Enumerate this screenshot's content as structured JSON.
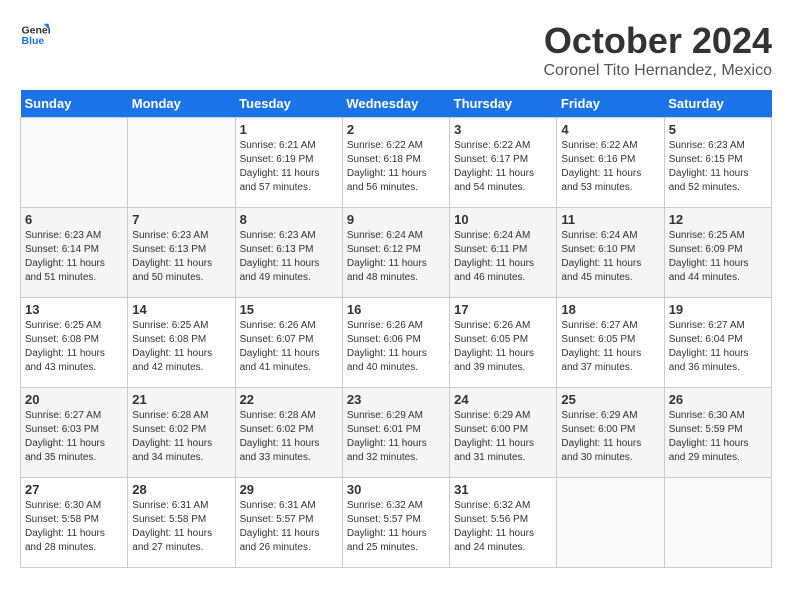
{
  "header": {
    "logo_general": "General",
    "logo_blue": "Blue",
    "month_title": "October 2024",
    "location": "Coronel Tito Hernandez, Mexico"
  },
  "days_of_week": [
    "Sunday",
    "Monday",
    "Tuesday",
    "Wednesday",
    "Thursday",
    "Friday",
    "Saturday"
  ],
  "weeks": [
    [
      {
        "day": "",
        "info": ""
      },
      {
        "day": "",
        "info": ""
      },
      {
        "day": "1",
        "info": "Sunrise: 6:21 AM\nSunset: 6:19 PM\nDaylight: 11 hours and 57 minutes."
      },
      {
        "day": "2",
        "info": "Sunrise: 6:22 AM\nSunset: 6:18 PM\nDaylight: 11 hours and 56 minutes."
      },
      {
        "day": "3",
        "info": "Sunrise: 6:22 AM\nSunset: 6:17 PM\nDaylight: 11 hours and 54 minutes."
      },
      {
        "day": "4",
        "info": "Sunrise: 6:22 AM\nSunset: 6:16 PM\nDaylight: 11 hours and 53 minutes."
      },
      {
        "day": "5",
        "info": "Sunrise: 6:23 AM\nSunset: 6:15 PM\nDaylight: 11 hours and 52 minutes."
      }
    ],
    [
      {
        "day": "6",
        "info": "Sunrise: 6:23 AM\nSunset: 6:14 PM\nDaylight: 11 hours and 51 minutes."
      },
      {
        "day": "7",
        "info": "Sunrise: 6:23 AM\nSunset: 6:13 PM\nDaylight: 11 hours and 50 minutes."
      },
      {
        "day": "8",
        "info": "Sunrise: 6:23 AM\nSunset: 6:13 PM\nDaylight: 11 hours and 49 minutes."
      },
      {
        "day": "9",
        "info": "Sunrise: 6:24 AM\nSunset: 6:12 PM\nDaylight: 11 hours and 48 minutes."
      },
      {
        "day": "10",
        "info": "Sunrise: 6:24 AM\nSunset: 6:11 PM\nDaylight: 11 hours and 46 minutes."
      },
      {
        "day": "11",
        "info": "Sunrise: 6:24 AM\nSunset: 6:10 PM\nDaylight: 11 hours and 45 minutes."
      },
      {
        "day": "12",
        "info": "Sunrise: 6:25 AM\nSunset: 6:09 PM\nDaylight: 11 hours and 44 minutes."
      }
    ],
    [
      {
        "day": "13",
        "info": "Sunrise: 6:25 AM\nSunset: 6:08 PM\nDaylight: 11 hours and 43 minutes."
      },
      {
        "day": "14",
        "info": "Sunrise: 6:25 AM\nSunset: 6:08 PM\nDaylight: 11 hours and 42 minutes."
      },
      {
        "day": "15",
        "info": "Sunrise: 6:26 AM\nSunset: 6:07 PM\nDaylight: 11 hours and 41 minutes."
      },
      {
        "day": "16",
        "info": "Sunrise: 6:26 AM\nSunset: 6:06 PM\nDaylight: 11 hours and 40 minutes."
      },
      {
        "day": "17",
        "info": "Sunrise: 6:26 AM\nSunset: 6:05 PM\nDaylight: 11 hours and 39 minutes."
      },
      {
        "day": "18",
        "info": "Sunrise: 6:27 AM\nSunset: 6:05 PM\nDaylight: 11 hours and 37 minutes."
      },
      {
        "day": "19",
        "info": "Sunrise: 6:27 AM\nSunset: 6:04 PM\nDaylight: 11 hours and 36 minutes."
      }
    ],
    [
      {
        "day": "20",
        "info": "Sunrise: 6:27 AM\nSunset: 6:03 PM\nDaylight: 11 hours and 35 minutes."
      },
      {
        "day": "21",
        "info": "Sunrise: 6:28 AM\nSunset: 6:02 PM\nDaylight: 11 hours and 34 minutes."
      },
      {
        "day": "22",
        "info": "Sunrise: 6:28 AM\nSunset: 6:02 PM\nDaylight: 11 hours and 33 minutes."
      },
      {
        "day": "23",
        "info": "Sunrise: 6:29 AM\nSunset: 6:01 PM\nDaylight: 11 hours and 32 minutes."
      },
      {
        "day": "24",
        "info": "Sunrise: 6:29 AM\nSunset: 6:00 PM\nDaylight: 11 hours and 31 minutes."
      },
      {
        "day": "25",
        "info": "Sunrise: 6:29 AM\nSunset: 6:00 PM\nDaylight: 11 hours and 30 minutes."
      },
      {
        "day": "26",
        "info": "Sunrise: 6:30 AM\nSunset: 5:59 PM\nDaylight: 11 hours and 29 minutes."
      }
    ],
    [
      {
        "day": "27",
        "info": "Sunrise: 6:30 AM\nSunset: 5:58 PM\nDaylight: 11 hours and 28 minutes."
      },
      {
        "day": "28",
        "info": "Sunrise: 6:31 AM\nSunset: 5:58 PM\nDaylight: 11 hours and 27 minutes."
      },
      {
        "day": "29",
        "info": "Sunrise: 6:31 AM\nSunset: 5:57 PM\nDaylight: 11 hours and 26 minutes."
      },
      {
        "day": "30",
        "info": "Sunrise: 6:32 AM\nSunset: 5:57 PM\nDaylight: 11 hours and 25 minutes."
      },
      {
        "day": "31",
        "info": "Sunrise: 6:32 AM\nSunset: 5:56 PM\nDaylight: 11 hours and 24 minutes."
      },
      {
        "day": "",
        "info": ""
      },
      {
        "day": "",
        "info": ""
      }
    ]
  ]
}
